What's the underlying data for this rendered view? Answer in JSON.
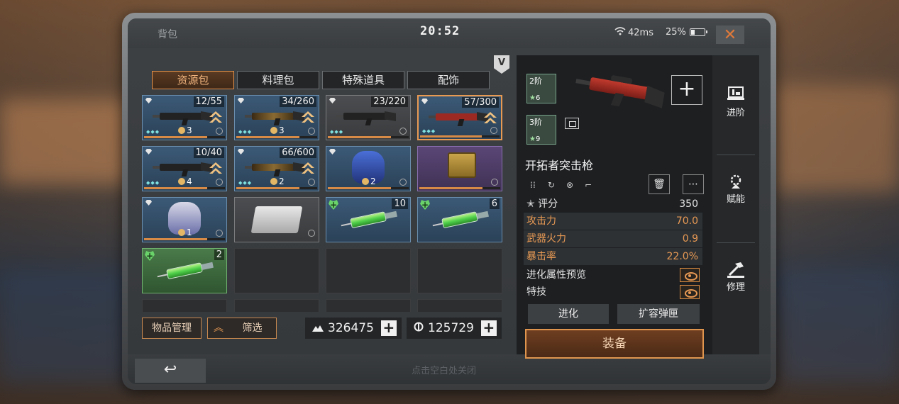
{
  "status": {
    "title": "背包",
    "time": "20:52",
    "ping": "42ms",
    "battery": "25%",
    "battery_fraction": 0.25
  },
  "vip_badge": "V",
  "tabs": [
    "资源包",
    "料理包",
    "特殊道具",
    "配饰"
  ],
  "active_tab": 0,
  "inventory": [
    {
      "qty": "12/55",
      "level": "3",
      "kind": "gun",
      "bg": "blue",
      "upgrade": true
    },
    {
      "qty": "34/260",
      "level": "3",
      "kind": "gun-gold",
      "bg": "blue",
      "upgrade": true
    },
    {
      "qty": "23/220",
      "level": "",
      "kind": "gun",
      "bg": "grey",
      "upgrade": false
    },
    {
      "qty": "57/300",
      "level": "",
      "kind": "gun-red",
      "bg": "blue",
      "upgrade": true,
      "selected": true
    },
    {
      "qty": "10/40",
      "level": "4",
      "kind": "gun",
      "bg": "blue",
      "upgrade": true
    },
    {
      "qty": "66/600",
      "level": "2",
      "kind": "gun-gold",
      "bg": "blue",
      "upgrade": true
    },
    {
      "qty": "",
      "level": "2",
      "kind": "armor",
      "bg": "blue",
      "upgrade": false
    },
    {
      "qty": "",
      "level": "",
      "kind": "chest",
      "bg": "purple",
      "upgrade": false
    },
    {
      "qty": "",
      "level": "1",
      "kind": "helmet",
      "bg": "blue",
      "upgrade": false
    },
    {
      "qty": "",
      "level": "",
      "kind": "medkit",
      "bg": "grey",
      "upgrade": false
    },
    {
      "qty": "10",
      "level": "",
      "kind": "syringe",
      "bg": "blue",
      "upgrade": false
    },
    {
      "qty": "6",
      "level": "",
      "kind": "syringe",
      "bg": "blue",
      "upgrade": false
    },
    {
      "qty": "2",
      "level": "",
      "kind": "syringe",
      "bg": "green",
      "upgrade": false
    }
  ],
  "controls": {
    "manage_label": "物品管理",
    "filter_label": "筛选",
    "currency_a": "326475",
    "currency_b": "125729",
    "back_icon": "undo-arrow-icon",
    "tap_close": "点击空白处关闭"
  },
  "detail": {
    "stage1": {
      "label": "2阶",
      "stars": "6"
    },
    "stage2": {
      "label": "3阶",
      "stars": "9"
    },
    "name": "开拓者突击枪",
    "score_label": "评分",
    "score": "350",
    "stats": [
      {
        "label": "攻击力",
        "value": "70.0"
      },
      {
        "label": "武器火力",
        "value": "0.9"
      },
      {
        "label": "暴击率",
        "value": "22.0%"
      }
    ],
    "evolve_preview": "进化属性预览",
    "special": "特技",
    "evolve_btn": "进化",
    "expand_btn": "扩容弹匣",
    "equip_btn": "装备"
  },
  "side_actions": [
    "进阶",
    "赋能",
    "修理"
  ],
  "colors": {
    "accent": "#e0954f",
    "panel": "#1d1f21"
  }
}
